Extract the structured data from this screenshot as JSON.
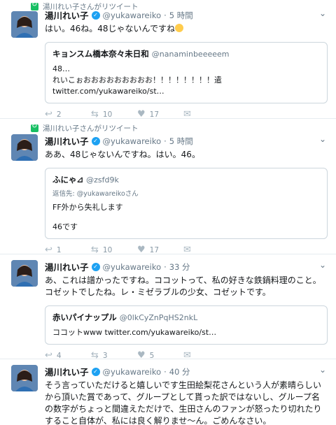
{
  "tweets": [
    {
      "retweet_label": "湯川れい子さんがリツイート",
      "author": {
        "name": "湯川れい子",
        "handle": "@yukawareiko",
        "time": "5 時間"
      },
      "text": "はい。46ね。48じゃないんですね",
      "quote": {
        "name": "キョンスム橋本奈々未日和",
        "handle": "@nanaminbeeeeem",
        "lines": [
          "48…",
          "れいこぉおおおおおおおおお！！！！！！！！遣",
          "twitter.com/yukawareiko/st…"
        ]
      },
      "actions": {
        "reply": "2",
        "retweet": "10",
        "like": "17"
      }
    },
    {
      "retweet_label": "湯川れい子さんがリツイート",
      "author": {
        "name": "湯川れい子",
        "handle": "@yukawareiko",
        "time": "5 時間"
      },
      "text": "ああ、48じゃないんですね。はい。46。",
      "quote": {
        "name": "ふにゃ⊿",
        "handle": "@zsfd9k",
        "reply_to": "返信先: @yukawareikoさん",
        "lines": [
          "FF外から失礼します",
          "46です"
        ]
      },
      "actions": {
        "reply": "1",
        "retweet": "10",
        "like": "17"
      }
    },
    {
      "author": {
        "name": "湯川れい子",
        "handle": "@yukawareiko",
        "time": "33 分"
      },
      "text": "あ、これは譜かったですね。ココットって、私の好きな鉄鍋料理のこと。コゼットでしたね。レ・ミゼラブルの少女、コゼットです。",
      "quote": {
        "name": "赤いパイナップル",
        "handle": "@0lkCyZnPqHS2nkL",
        "lines": [
          "ココットwww twitter.com/yukawareiko/st…"
        ]
      },
      "actions": {
        "reply": "4",
        "retweet": "3",
        "like": "5"
      }
    },
    {
      "author": {
        "name": "湯川れい子",
        "handle": "@yukawareiko",
        "time": "40 分"
      },
      "text": "そう言っていただけると嬉しいです生田絵梨花さんという人が素晴らしいから頂いた賞であって、グループとして貰った訳ではないし、グループ名の数字がちょっと間違えただけで、生田さんのファンが怒ったり切れたりすること自体が、私には良く解りませ〜ん。ごめんなさい。"
    }
  ],
  "colors": {
    "verified": "#1da1f2",
    "retweet_green": "#17bf63",
    "muted": "#657786"
  }
}
